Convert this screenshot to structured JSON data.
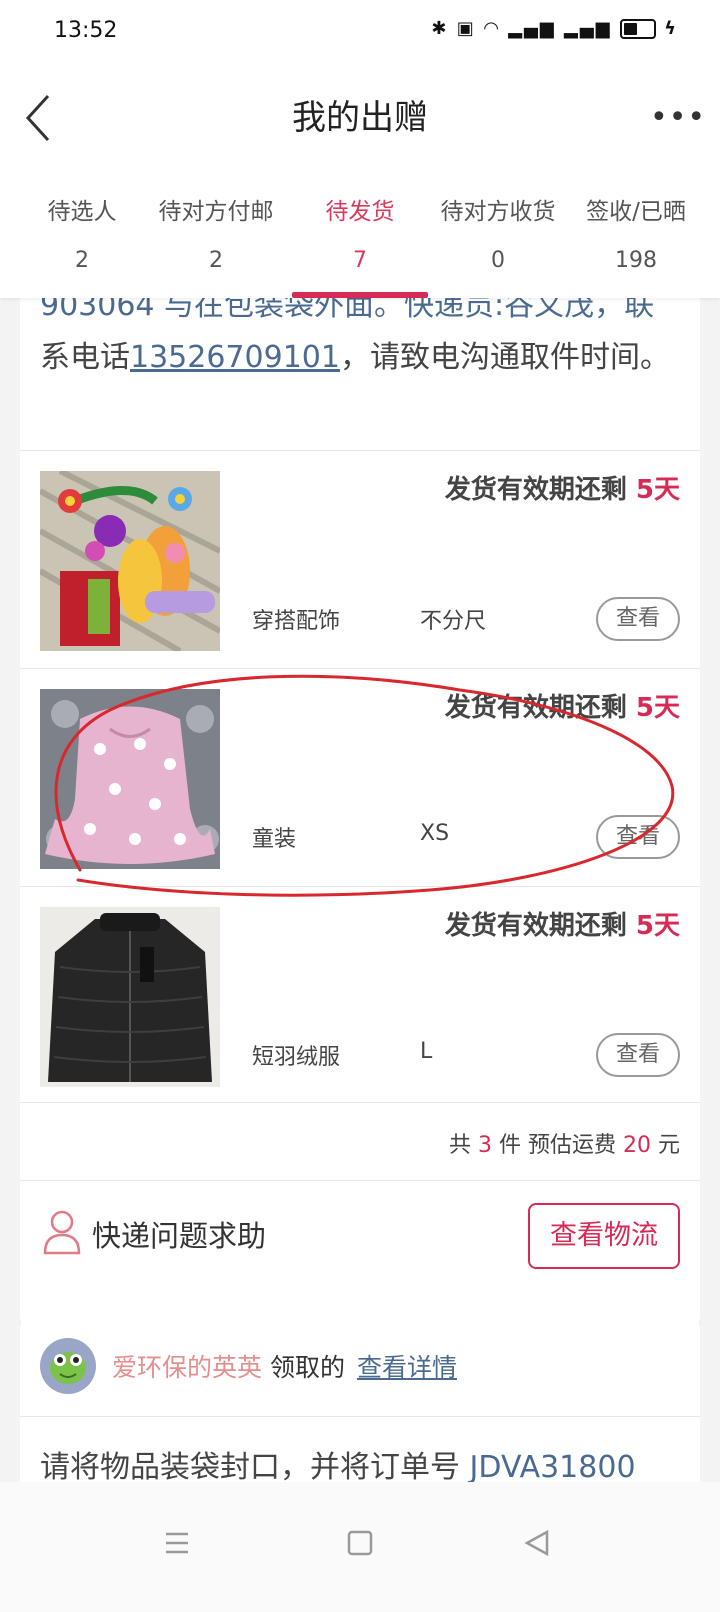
{
  "status_bar": {
    "time": "13:52"
  },
  "header": {
    "title": "我的出赠"
  },
  "tabs": [
    {
      "label": "待选人",
      "count": "2"
    },
    {
      "label": "待对方付邮",
      "count": "2"
    },
    {
      "label": "待发货",
      "count": "7",
      "active": true
    },
    {
      "label": "待对方收货",
      "count": "0"
    },
    {
      "label": "签收/已晒",
      "count": "198"
    }
  ],
  "card1": {
    "notice_line1": "903064 与在包装袋外面。快递员:谷义茂，联",
    "notice_pre_phone": "系电话",
    "notice_phone": "13526709101",
    "notice_post_phone": "，请致电沟通取件时间。",
    "items": [
      {
        "deadline_label": "发货有效期还剩",
        "deadline_days": "5天",
        "category": "穿搭配饰",
        "size": "不分尺",
        "view_label": "查看"
      },
      {
        "deadline_label": "发货有效期还剩",
        "deadline_days": "5天",
        "category": "童装",
        "size": "XS",
        "view_label": "查看"
      },
      {
        "deadline_label": "发货有效期还剩",
        "deadline_days": "5天",
        "category": "短羽绒服",
        "size": "L",
        "view_label": "查看"
      }
    ],
    "summary": {
      "prefix": "共",
      "count": "3",
      "mid": "件 预估运费",
      "fee": "20",
      "suffix": "元"
    },
    "help_text": "快递问题求助",
    "logistics_button": "查看物流"
  },
  "card2": {
    "claimer": "爱环保的英英",
    "claim_action": "领取的",
    "details_link": "查看详情",
    "notice_text": "请将物品装袋封口，并将订单号",
    "order_no": "JDVA31800"
  },
  "colors": {
    "accent": "#d72b55",
    "link": "#4a6a92",
    "claimer": "#e58e8e",
    "annotation": "#d9272e"
  }
}
